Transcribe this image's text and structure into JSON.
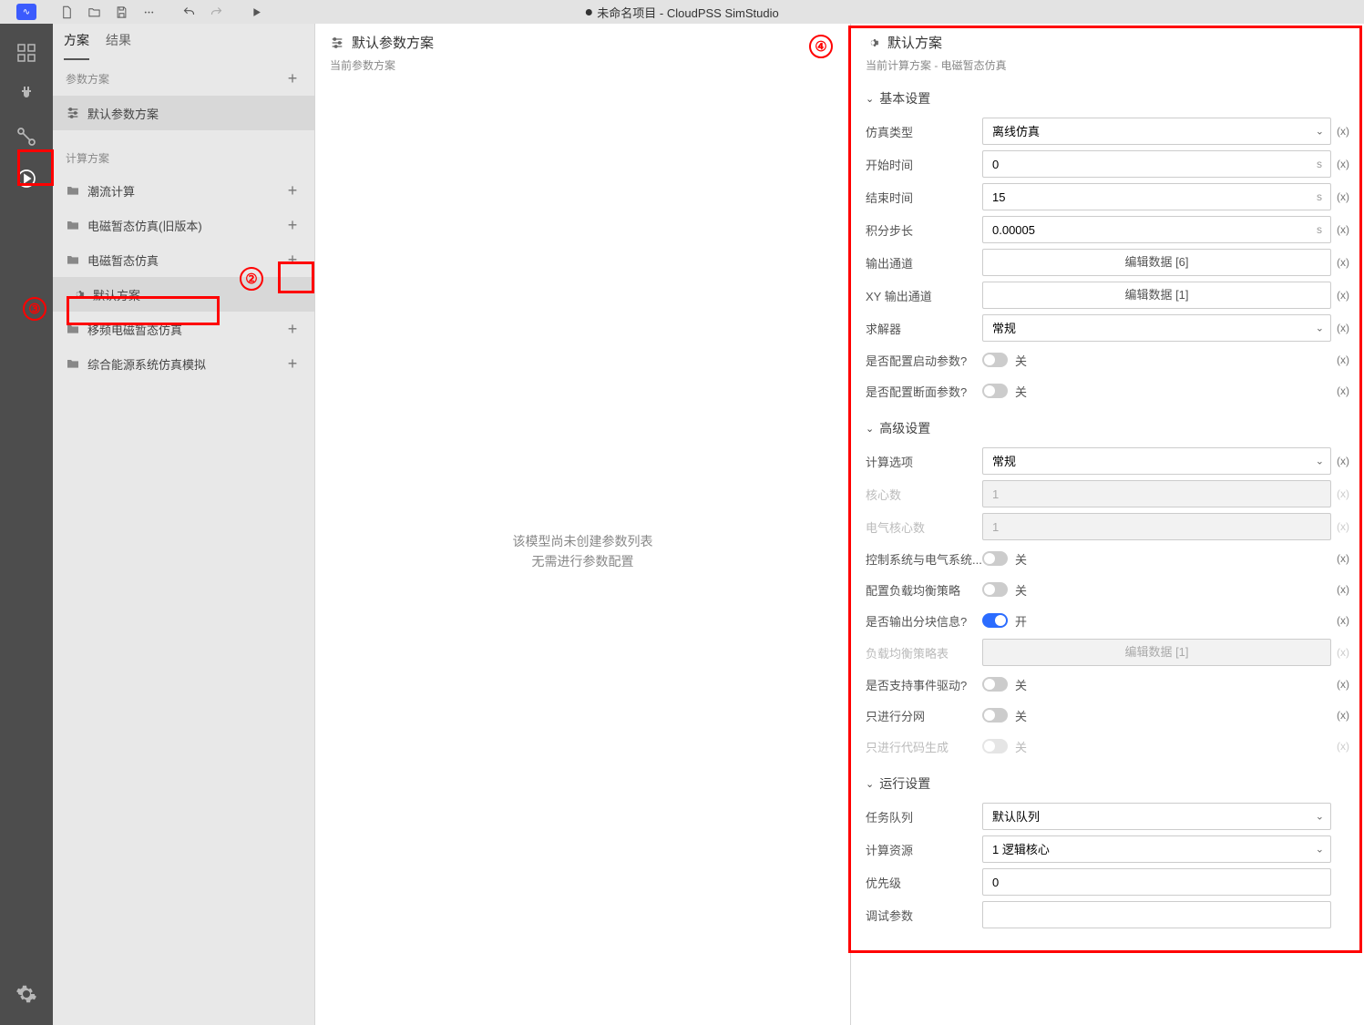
{
  "title": "未命名项目 - CloudPSS SimStudio",
  "tabs": {
    "scheme": "方案",
    "result": "结果"
  },
  "groups": {
    "param": "参数方案",
    "calc": "计算方案"
  },
  "tree": {
    "default_param": "默认参数方案",
    "items": [
      {
        "label": "潮流计算"
      },
      {
        "label": "电磁暂态仿真(旧版本)"
      },
      {
        "label": "电磁暂态仿真"
      },
      {
        "label": "默认方案"
      },
      {
        "label": "移频电磁暂态仿真"
      },
      {
        "label": "综合能源系统仿真模拟"
      }
    ]
  },
  "middle": {
    "title": "默认参数方案",
    "sub": "当前参数方案",
    "empty1": "该模型尚未创建参数列表",
    "empty2": "无需进行参数配置"
  },
  "props": {
    "title": "默认方案",
    "sub": "当前计算方案 - 电磁暂态仿真",
    "sections": {
      "basic": "基本设置",
      "advanced": "高级设置",
      "run": "运行设置"
    },
    "rows": {
      "sim_type": {
        "label": "仿真类型",
        "value": "离线仿真"
      },
      "start_time": {
        "label": "开始时间",
        "value": "0",
        "unit": "s"
      },
      "end_time": {
        "label": "结束时间",
        "value": "15",
        "unit": "s"
      },
      "step": {
        "label": "积分步长",
        "value": "0.00005",
        "unit": "s"
      },
      "out_ch": {
        "label": "输出通道",
        "btn": "编辑数据 [6]"
      },
      "xy_ch": {
        "label": "XY 输出通道",
        "btn": "编辑数据 [1]"
      },
      "solver": {
        "label": "求解器",
        "value": "常规"
      },
      "cfg_start": {
        "label": "是否配置启动参数?",
        "state": "关"
      },
      "cfg_snap": {
        "label": "是否配置断面参数?",
        "state": "关"
      },
      "calc_opt": {
        "label": "计算选项",
        "value": "常规"
      },
      "cores": {
        "label": "核心数",
        "value": "1"
      },
      "elec_cores": {
        "label": "电气核心数",
        "value": "1"
      },
      "ctrl_elec": {
        "label": "控制系统与电气系统...",
        "state": "关"
      },
      "lb_strategy": {
        "label": "配置负载均衡策略",
        "state": "关"
      },
      "out_block": {
        "label": "是否输出分块信息?",
        "state": "开"
      },
      "lb_table": {
        "label": "负载均衡策略表",
        "btn": "编辑数据 [1]"
      },
      "event_drv": {
        "label": "是否支持事件驱动?",
        "state": "关"
      },
      "only_part": {
        "label": "只进行分网",
        "state": "关"
      },
      "only_code": {
        "label": "只进行代码生成",
        "state": "关"
      },
      "queue": {
        "label": "任务队列",
        "value": "默认队列"
      },
      "resource": {
        "label": "计算资源",
        "value": "1 逻辑核心"
      },
      "priority": {
        "label": "优先级",
        "value": "0"
      },
      "debug": {
        "label": "调试参数",
        "value": ""
      }
    }
  },
  "xbtn": "(x)"
}
